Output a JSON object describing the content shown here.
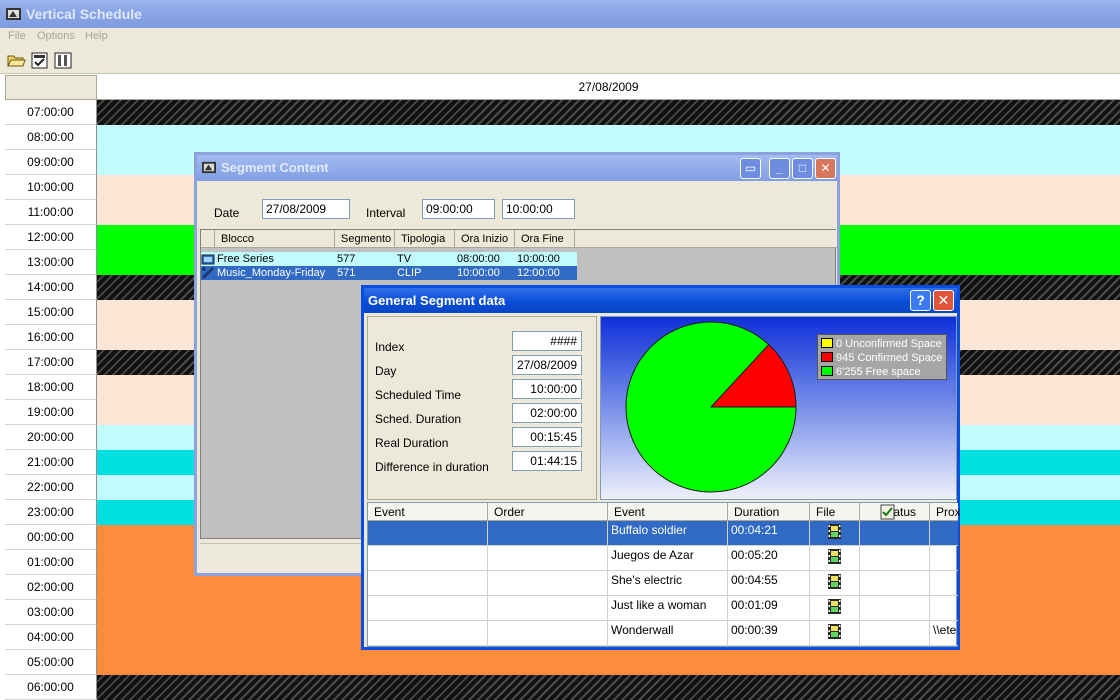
{
  "app": {
    "title": "Vertical Schedule"
  },
  "menu": {
    "items": [
      "File",
      "Options",
      "Help"
    ]
  },
  "toolbar": {
    "buttons": [
      "open-folder-icon",
      "properties-icon",
      "columns-icon"
    ]
  },
  "schedule": {
    "date": "27/08/2009",
    "rows": [
      {
        "time": "07:00:00",
        "fill": "hatched"
      },
      {
        "time": "08:00:00",
        "fill": "#c2fbfb"
      },
      {
        "time": "09:00:00",
        "fill": "#c2fbfb"
      },
      {
        "time": "10:00:00",
        "fill": "#fbe6d6"
      },
      {
        "time": "11:00:00",
        "fill": "#fbe6d6"
      },
      {
        "time": "12:00:00",
        "fill": "#00ff00"
      },
      {
        "time": "13:00:00",
        "fill": "#00ff00"
      },
      {
        "time": "14:00:00",
        "fill": "hatched"
      },
      {
        "time": "15:00:00",
        "fill": "#fbe6d6"
      },
      {
        "time": "16:00:00",
        "fill": "#fbe6d6"
      },
      {
        "time": "17:00:00",
        "fill": "hatched"
      },
      {
        "time": "18:00:00",
        "fill": "#fbe6d6"
      },
      {
        "time": "19:00:00",
        "fill": "#fbe6d6"
      },
      {
        "time": "20:00:00",
        "fill": "#c2fbfb"
      },
      {
        "time": "21:00:00",
        "fill": "#00e0e0"
      },
      {
        "time": "22:00:00",
        "fill": "#c2fbfb"
      },
      {
        "time": "23:00:00",
        "fill": "#00e0e0"
      },
      {
        "time": "00:00:00",
        "fill": "#ff8c3c"
      },
      {
        "time": "01:00:00",
        "fill": "#ff8c3c"
      },
      {
        "time": "02:00:00",
        "fill": "#ff8c3c"
      },
      {
        "time": "03:00:00",
        "fill": "#ff8c3c"
      },
      {
        "time": "04:00:00",
        "fill": "#ff8c3c"
      },
      {
        "time": "05:00:00",
        "fill": "#ff8c3c"
      },
      {
        "time": "06:00:00",
        "fill": "hatched"
      }
    ]
  },
  "segment_window": {
    "title": "Segment Content",
    "date_label": "Date",
    "date_value": "27/08/2009",
    "interval_label": "Interval",
    "interval_from": "09:00:00",
    "interval_to": "10:00:00",
    "columns": [
      "Blocco",
      "Segmento",
      "Tipologia",
      "Ora Inizio",
      "Ora Fine"
    ],
    "rows": [
      {
        "blocco": "Free Series",
        "segmento": "577",
        "tipologia": "TV",
        "inizio": "08:00:00",
        "fine": "10:00:00",
        "selected": false
      },
      {
        "blocco": "Music_Monday-Friday",
        "segmento": "571",
        "tipologia": "CLIP",
        "inizio": "10:00:00",
        "fine": "12:00:00",
        "selected": true
      }
    ]
  },
  "general_dialog": {
    "title": "General Segment data",
    "fields": [
      {
        "label": "Index",
        "value": "####"
      },
      {
        "label": "Day",
        "value": "27/08/2009"
      },
      {
        "label": "Scheduled Time",
        "value": "10:00:00"
      },
      {
        "label": "Sched. Duration",
        "value": "02:00:00"
      },
      {
        "label": "Real Duration",
        "value": "00:15:45"
      },
      {
        "label": "Difference in duration",
        "value": "01:44:15"
      }
    ],
    "table": {
      "columns": [
        "Event",
        "Order",
        "Event",
        "Duration",
        "File",
        "Status",
        "Prox"
      ],
      "rows": [
        {
          "event_left": "",
          "order": "",
          "event": "Buffalo soldier",
          "duration": "00:04:21",
          "status": "",
          "prox": "",
          "selected": true
        },
        {
          "event_left": "",
          "order": "",
          "event": "Juegos de Azar",
          "duration": "00:05:20",
          "status": "",
          "prox": "",
          "selected": false
        },
        {
          "event_left": "",
          "order": "",
          "event": "She's electric",
          "duration": "00:04:55",
          "status": "",
          "prox": "",
          "selected": false
        },
        {
          "event_left": "",
          "order": "",
          "event": "Just like a woman",
          "duration": "00:01:09",
          "status": "",
          "prox": "",
          "selected": false
        },
        {
          "event_left": "",
          "order": "",
          "event": "Wonderwall",
          "duration": "00:00:39",
          "status": "",
          "prox": "\\\\ete",
          "selected": false
        }
      ]
    }
  },
  "chart_data": {
    "type": "pie",
    "title": "",
    "slices": [
      {
        "label": "0 Unconfirmed Space",
        "value": 0,
        "color": "#ffff00"
      },
      {
        "label": "945 Confirmed Space",
        "value": 945,
        "color": "#ff0000"
      },
      {
        "label": "6'255 Free space",
        "value": 6255,
        "color": "#00ff00"
      }
    ],
    "legend_position": "top-right"
  }
}
